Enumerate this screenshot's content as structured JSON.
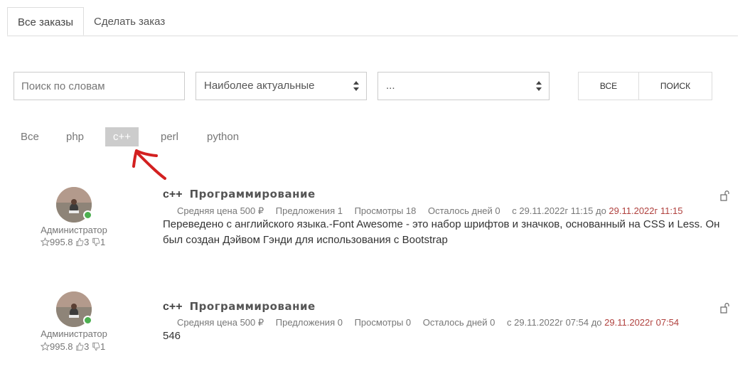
{
  "tabs": [
    {
      "label": "Все заказы",
      "active": true
    },
    {
      "label": "Сделать заказ",
      "active": false
    }
  ],
  "filters": {
    "search_placeholder": "Поиск по словам",
    "sort_selected": "Наиболее актуальные",
    "category_selected": "...",
    "all_button": "ВСЕ",
    "search_button": "ПОИСК"
  },
  "tags": [
    {
      "label": "Все",
      "selected": false
    },
    {
      "label": "php",
      "selected": false
    },
    {
      "label": "c++",
      "selected": true
    },
    {
      "label": "perl",
      "selected": false
    },
    {
      "label": "python",
      "selected": false
    }
  ],
  "colors": {
    "accent_red": "#b0413e",
    "annotation_arrow": "#d32020",
    "online": "#4caf50",
    "selected_tag_bg": "#cccccc"
  },
  "orders": [
    {
      "author_role": "Администратор",
      "rating": "995.8",
      "likes": "3",
      "dislikes": "1",
      "title": "c++",
      "category": "Программирование",
      "price": "Средняя цена 500 ₽",
      "offers": "Предложения 1",
      "views": "Просмотры 18",
      "days_left": "Осталось дней 0",
      "date_from": "с 29.11.2022г 11:15 до",
      "date_to": "29.11.2022г 11:15",
      "description": "Переведено с английского языка.-Font Awesome - это набор шрифтов и значков, основанный на CSS и Less. Он был создан Дэйвом Гэнди для использования с Bootstrap",
      "icon": "unlock-icon"
    },
    {
      "author_role": "Администратор",
      "rating": "995.8",
      "likes": "3",
      "dislikes": "1",
      "title": "c++",
      "category": "Программирование",
      "price": "Средняя цена 500 ₽",
      "offers": "Предложения 0",
      "views": "Просмотры 0",
      "days_left": "Осталось дней 0",
      "date_from": "с 29.11.2022г 07:54 до",
      "date_to": "29.11.2022г 07:54",
      "description": "546",
      "icon": "unlock-icon"
    }
  ]
}
